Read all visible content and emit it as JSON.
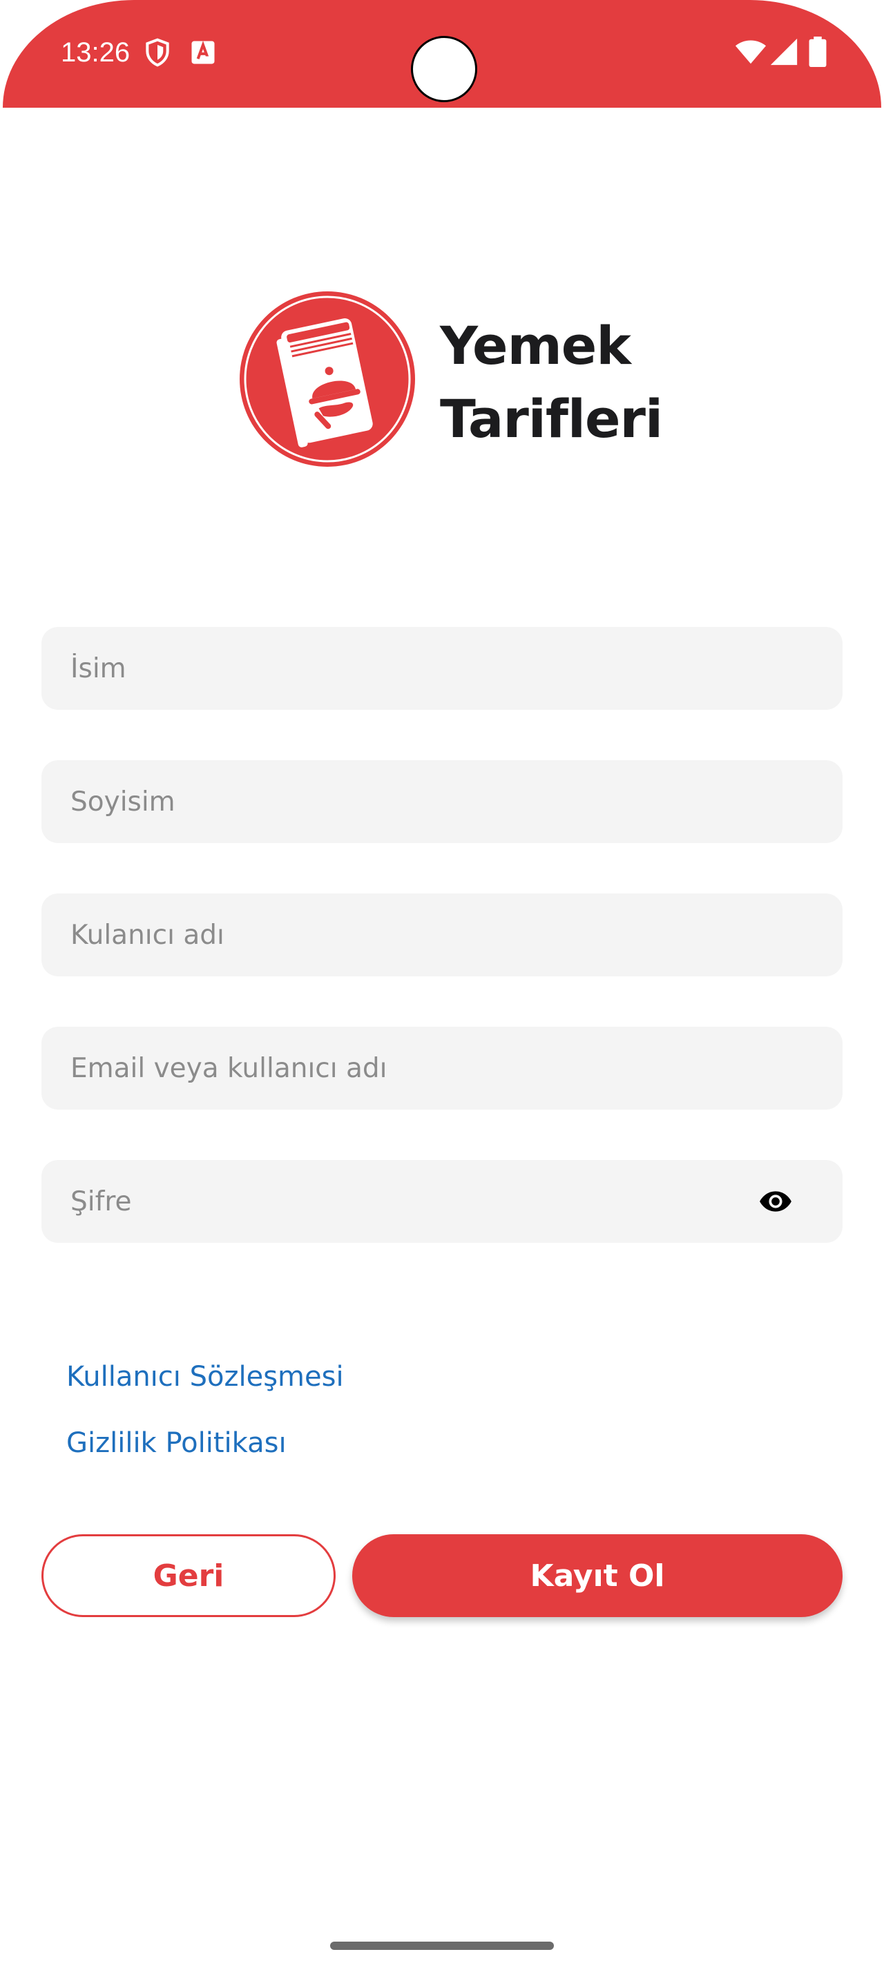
{
  "status_bar": {
    "time": "13:26",
    "icons": [
      "shield-icon",
      "font-a-icon",
      "wifi-icon",
      "signal-icon",
      "battery-icon"
    ],
    "color": "#e33d3f"
  },
  "header": {
    "logo_icon": "recipe-book-icon",
    "title_line1": "Yemek",
    "title_line2": "Tarifleri"
  },
  "form": {
    "first_name": {
      "value": "",
      "placeholder": "İsim"
    },
    "last_name": {
      "value": "",
      "placeholder": "Soyisim"
    },
    "username": {
      "value": "",
      "placeholder": "Kulanıcı adı"
    },
    "email": {
      "value": "",
      "placeholder": "Email veya kullanıcı adı"
    },
    "password": {
      "value": "",
      "placeholder": "Şifre",
      "toggle_icon": "eye-icon"
    }
  },
  "links": {
    "user_agreement": "Kullanıcı Sözleşmesi",
    "privacy_policy": "Gizlilik Politikası"
  },
  "actions": {
    "back_label": "Geri",
    "register_label": "Kayıt Ol"
  },
  "colors": {
    "accent": "#e33d3f",
    "link": "#1e6fbd",
    "field_background": "#f4f4f4"
  }
}
